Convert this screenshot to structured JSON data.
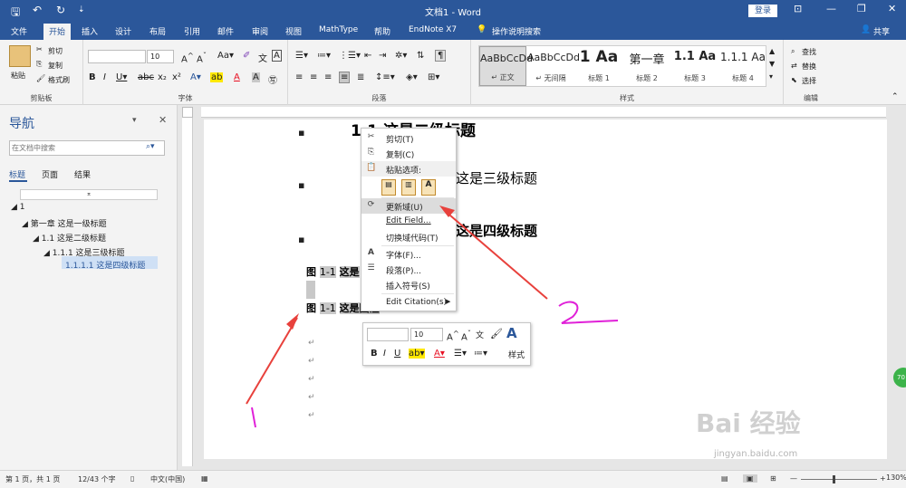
{
  "title_bar": {
    "doc_title": "文档1 - Word",
    "sign_in": "登录",
    "quick_access": {
      "save": "🖫",
      "undo": "↶",
      "redo": "↻",
      "customize": "⇣"
    },
    "window_controls": {
      "ribbon_options": "⊡",
      "minimize": "—",
      "restore": "❐",
      "close": "✕"
    }
  },
  "tabs": [
    "文件",
    "开始",
    "插入",
    "设计",
    "布局",
    "引用",
    "邮件",
    "审阅",
    "视图",
    "MathType",
    "帮助",
    "EndNote X7"
  ],
  "tell_me": "操作说明搜索",
  "share": "共享",
  "ribbon": {
    "clipboard": {
      "label": "剪贴板",
      "paste": "粘贴",
      "cut": "剪切",
      "copy": "复制",
      "format_painter": "格式刷"
    },
    "font": {
      "label": "字体",
      "size": "10"
    },
    "paragraph": {
      "label": "段落"
    },
    "styles": {
      "label": "样式",
      "items": [
        {
          "preview": "AaBbCcDd",
          "name": "↵ 正文"
        },
        {
          "preview": "AaBbCcDd",
          "name": "↵ 无间隔"
        },
        {
          "preview": "1 Aa",
          "name": "标题 1"
        },
        {
          "preview": "第一章",
          "name": "标题 2"
        },
        {
          "preview": "1.1 Aa",
          "name": "标题 3"
        },
        {
          "preview": "1.1.1 Aa",
          "name": "标题 4"
        }
      ]
    },
    "editing": {
      "label": "编辑",
      "find": "查找",
      "replace": "替换",
      "select": "选择"
    }
  },
  "nav_pane": {
    "title": "导航",
    "search_placeholder": "在文档中搜索",
    "tabs": [
      "标题",
      "页面",
      "结果"
    ],
    "tree": [
      {
        "text": "1",
        "level": 0
      },
      {
        "text": "第一章 这是一级标题",
        "level": 1
      },
      {
        "text": "1.1 这是二级标题",
        "level": 2
      },
      {
        "text": "1.1.1 这是三级标题",
        "level": 3
      },
      {
        "text": "1.1.1.1 这是四级标题",
        "level": 4
      }
    ]
  },
  "document": {
    "h2": "1.1 这是二级标题",
    "h3": "这是三级标题",
    "h4": "这是四级标题",
    "caption1_label": "图",
    "caption1_num": "1-1",
    "caption1_text": "这是",
    "caption2_label": "图",
    "caption2_num": "1-1",
    "caption2_text": "这是图注",
    "para_mark": "↵",
    "bullet": "▪"
  },
  "context_menu": {
    "cut": "剪切(T)",
    "copy": "复制(C)",
    "paste_options": "粘贴选项:",
    "update_field": "更新域(U)",
    "edit_field": "Edit Field...",
    "toggle_field_codes": "切换域代码(T)",
    "font": "字体(F)...",
    "paragraph": "段落(P)...",
    "insert_symbol": "插入符号(S)",
    "edit_citation": "Edit Citation(s)"
  },
  "mini_toolbar": {
    "size": "10",
    "styles_label": "样式"
  },
  "annotations": {
    "label1": "1",
    "label2": "2",
    "color_arrow": "#e8413c",
    "color_label": "#e020d8"
  },
  "status_bar": {
    "page": "第 1 页，共 1 页",
    "words": "12/43 个字",
    "language": "中文(中国)",
    "zoom": "130%"
  },
  "watermark": {
    "main": "Bai 经验",
    "sub": "jingyan.baidu.com"
  },
  "badge": "70"
}
